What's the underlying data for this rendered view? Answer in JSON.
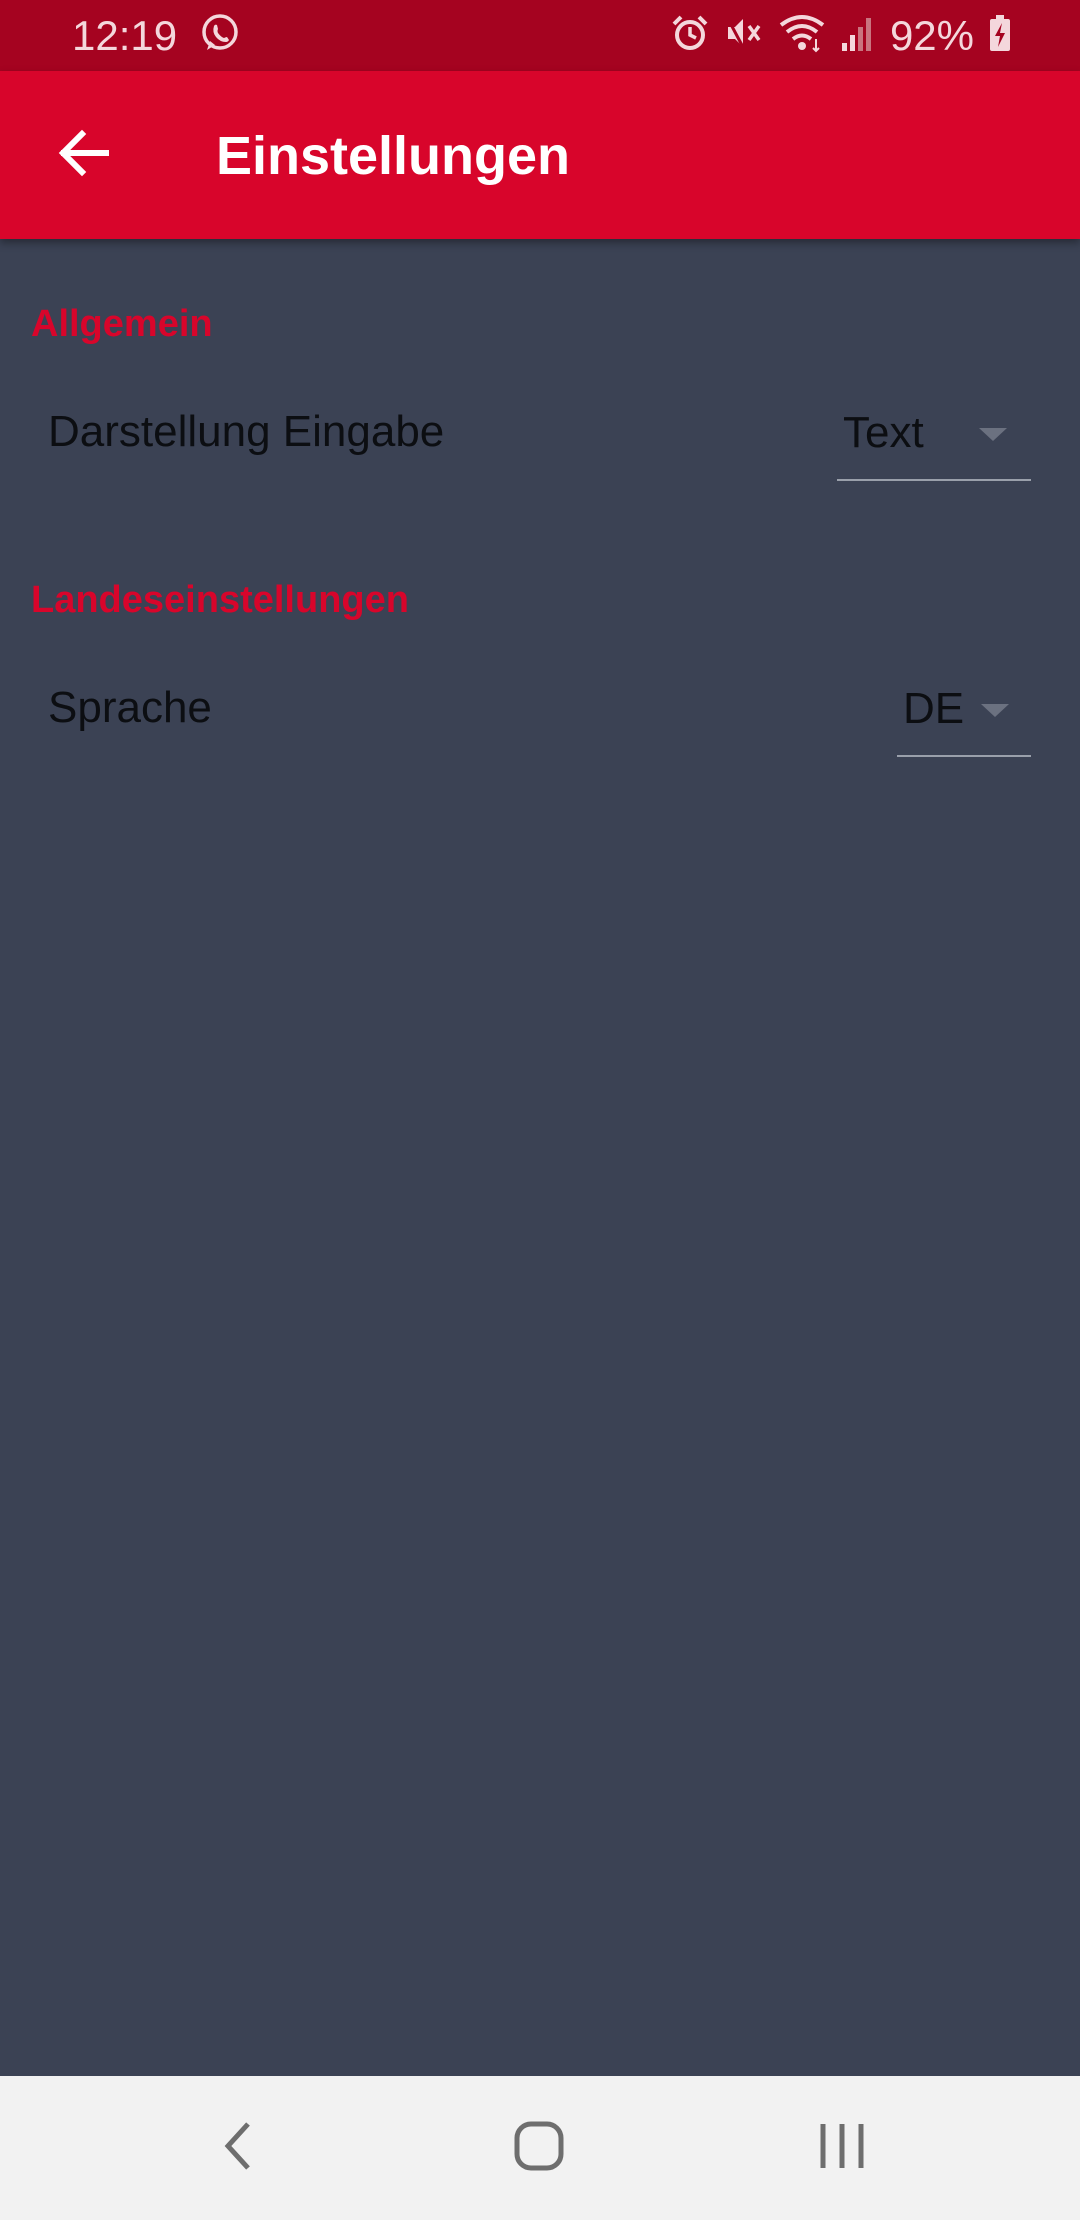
{
  "status_bar": {
    "time": "12:19",
    "battery_percent": "92%",
    "icons": [
      "whatsapp-icon",
      "alarm-icon",
      "mute-icon",
      "wifi-icon",
      "signal-icon",
      "battery-charging-icon"
    ]
  },
  "app_bar": {
    "title": "Einstellungen",
    "back_icon": "arrow-left-icon",
    "color": "#d8052b"
  },
  "sections": [
    {
      "header": "Allgemein",
      "items": [
        {
          "label": "Darstellung Eingabe",
          "value": "Text"
        }
      ]
    },
    {
      "header": "Landeseinstellungen",
      "items": [
        {
          "label": "Sprache",
          "value": "DE"
        }
      ]
    }
  ],
  "nav_bar": {
    "buttons": [
      "back-icon",
      "home-icon",
      "recent-apps-icon"
    ]
  },
  "colors": {
    "accent": "#d8052b",
    "status_bar": "#a50320",
    "background": "#3b4254",
    "nav_bar": "#f2f2f2"
  }
}
